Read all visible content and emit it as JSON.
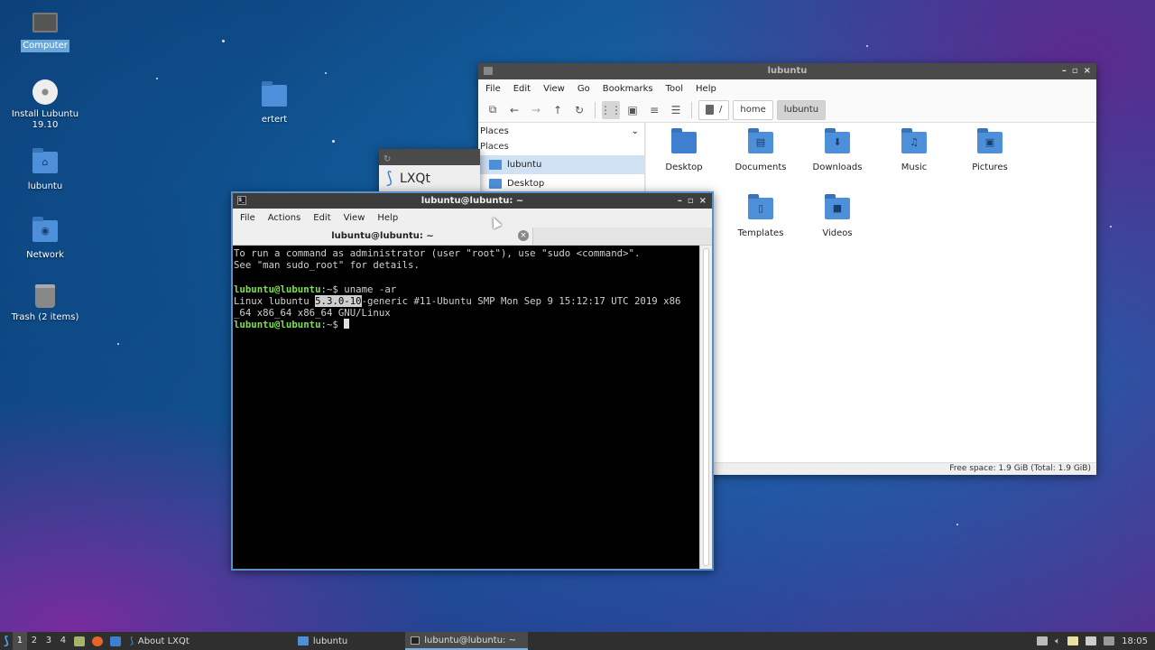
{
  "desktop": {
    "icons": [
      {
        "label": "Computer",
        "icon": "computer-icon"
      },
      {
        "label": "Install Lubuntu 19.10",
        "icon": "install-disc-icon"
      },
      {
        "label": "lubuntu",
        "icon": "home-folder-icon"
      },
      {
        "label": "Network",
        "icon": "network-folder-icon"
      },
      {
        "label": "Trash (2 items)",
        "icon": "trash-icon"
      },
      {
        "label": "ertert",
        "icon": "folder-icon"
      }
    ]
  },
  "file_manager": {
    "title": "lubuntu",
    "menu": [
      "File",
      "Edit",
      "View",
      "Go",
      "Bookmarks",
      "Tool",
      "Help"
    ],
    "path": [
      "/",
      "home",
      "lubuntu"
    ],
    "sidebar": {
      "header": "Places",
      "section": "Places",
      "items": [
        "lubuntu",
        "Desktop"
      ]
    },
    "items": [
      {
        "label": "Desktop",
        "icon": "desktop-folder-icon"
      },
      {
        "label": "Documents",
        "icon": "documents-folder-icon"
      },
      {
        "label": "Downloads",
        "icon": "downloads-folder-icon"
      },
      {
        "label": "Music",
        "icon": "music-folder-icon"
      },
      {
        "label": "Pictures",
        "icon": "pictures-folder-icon"
      },
      {
        "label": "Templates",
        "icon": "templates-folder-icon"
      },
      {
        "label": "Videos",
        "icon": "videos-folder-icon"
      }
    ],
    "status": "Free space: 1.9 GiB (Total: 1.9 GiB)"
  },
  "about_window": {
    "title": "LXQt"
  },
  "terminal": {
    "title": "lubuntu@lubuntu: ~",
    "menu": [
      "File",
      "Actions",
      "Edit",
      "View",
      "Help"
    ],
    "tab": "lubuntu@lubuntu: ~",
    "line1": "To run a command as administrator (user \"root\"), use \"sudo <command>\".",
    "line2": "See \"man sudo_root\" for details.",
    "prompt": "lubuntu@lubuntu",
    "prompt_suffix": ":~$",
    "command": " uname -ar",
    "out_a": "Linux lubuntu ",
    "out_hl": "5.3.0-10",
    "out_b": "-generic #11-Ubuntu SMP Mon Sep 9 15:12:17 UTC 2019 x86",
    "out_c": "_64 x86_64 x86_64 GNU/Linux"
  },
  "taskbar": {
    "workspaces": [
      "1",
      "2",
      "3",
      "4"
    ],
    "active_workspace": "1",
    "tasks": [
      {
        "label": "About LXQt"
      },
      {
        "label": "lubuntu"
      },
      {
        "label": "lubuntu@lubuntu: ~"
      }
    ],
    "clock": "18:05"
  },
  "colors": {
    "prompt": "#7fe04e",
    "folder": "#4d8fd8",
    "selection": "#cfe1f3"
  }
}
